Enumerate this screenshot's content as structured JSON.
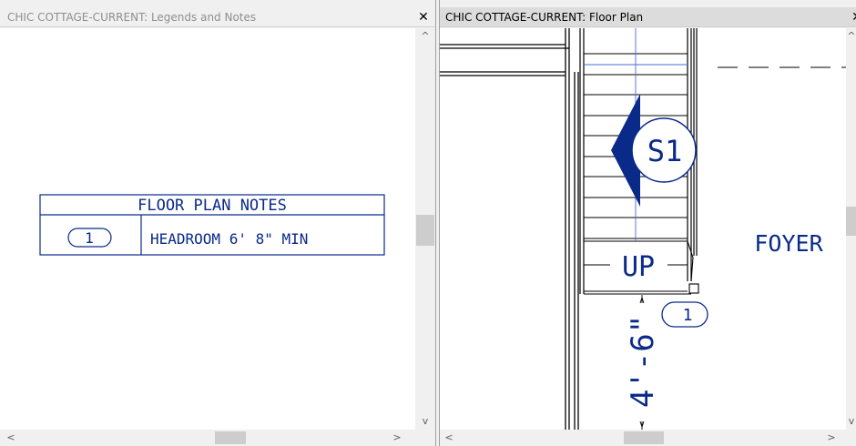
{
  "left_panel": {
    "title": "CHIC COTTAGE-CURRENT: Legends and Notes",
    "close_label": "✕",
    "notes_table": {
      "heading": "FLOOR PLAN NOTES",
      "rows": [
        {
          "number": "1",
          "text": "HEADROOM 6' 8\" MIN"
        }
      ]
    }
  },
  "right_panel": {
    "title": "CHIC COTTAGE-CURRENT: Floor Plan",
    "close_label": "✕",
    "plan": {
      "section_marker": "S1",
      "stair_label": "UP",
      "room_label": "FOYER",
      "dimension": "4'-6\"",
      "note_callout": "1"
    }
  },
  "scrollbar_arrows": {
    "up": "^",
    "down": "v",
    "left": "<",
    "right": ">"
  },
  "colors": {
    "cad_blue": "#0a2a8a",
    "line_black": "#000000",
    "pane_bg": "#ffffff",
    "chrome_bg": "#f0f0f0"
  }
}
